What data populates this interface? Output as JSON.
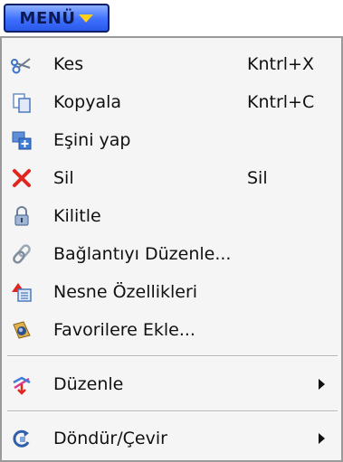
{
  "menu_button": {
    "label": "MENÜ",
    "icon": "dropdown-arrow-icon"
  },
  "items": [
    {
      "label": "Kes",
      "shortcut": "Kntrl+X",
      "icon": "scissors-icon"
    },
    {
      "label": "Kopyala",
      "shortcut": "Kntrl+C",
      "icon": "copy-icon"
    },
    {
      "label": "Eşini yap",
      "shortcut": "",
      "icon": "duplicate-icon"
    },
    {
      "label": "Sil",
      "shortcut": "Sil",
      "icon": "delete-icon"
    },
    {
      "label": "Kilitle",
      "shortcut": "",
      "icon": "lock-icon"
    },
    {
      "label": "Bağlantıyı Düzenle...",
      "shortcut": "",
      "icon": "link-icon"
    },
    {
      "label": "Nesne Özellikleri",
      "shortcut": "",
      "icon": "properties-icon"
    },
    {
      "label": "Favorilere Ekle...",
      "shortcut": "",
      "icon": "favorites-icon"
    },
    {
      "label": "Düzenle",
      "shortcut": "",
      "icon": "arrange-icon",
      "submenu": true
    },
    {
      "label": "Döndür/Çevir",
      "shortcut": "",
      "icon": "rotate-flip-icon",
      "submenu": true
    }
  ]
}
